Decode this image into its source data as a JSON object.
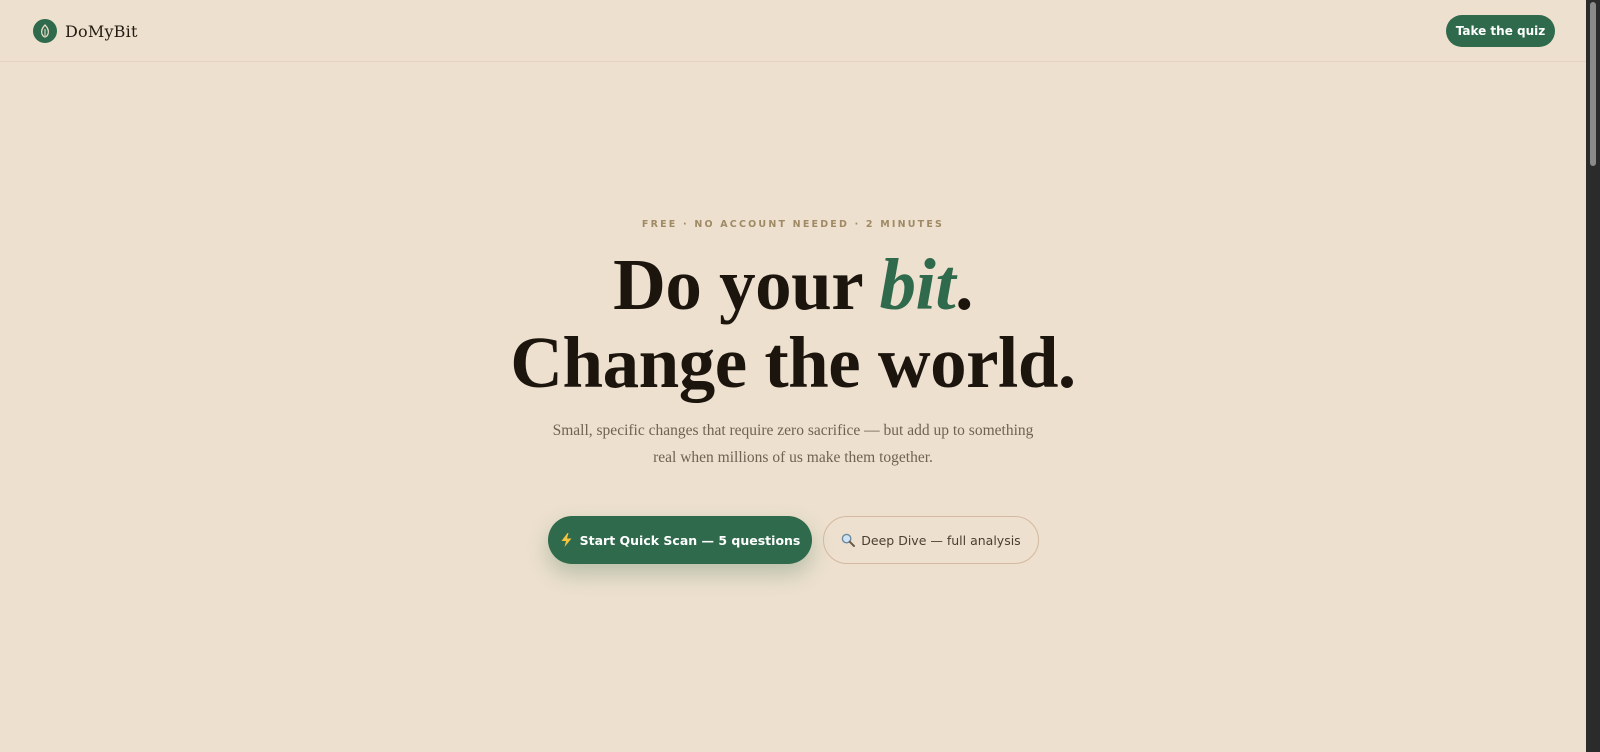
{
  "header": {
    "brand_name": "DoMyBit",
    "cta_label": "Take the quiz"
  },
  "hero": {
    "eyebrow": "FREE · NO ACCOUNT NEEDED · 2 MINUTES",
    "headline_line1_prefix": "Do your ",
    "headline_line1_accent": "bit",
    "headline_line1_suffix": ".",
    "headline_line2": "Change the world.",
    "subtitle": "Small, specific changes that require zero sacrifice — but add up to something real when millions of us make them together.",
    "primary_button": {
      "icon": "lightning-icon",
      "label": "Start Quick Scan — 5 questions"
    },
    "secondary_button": {
      "icon": "magnifier-icon",
      "label": "Deep Dive — full analysis"
    }
  },
  "colors": {
    "background": "#ede0ce",
    "brand_green": "#2e6a4b",
    "text_dark": "#1c150e",
    "eyebrow": "#a08a66",
    "muted_text": "#6f6252"
  }
}
